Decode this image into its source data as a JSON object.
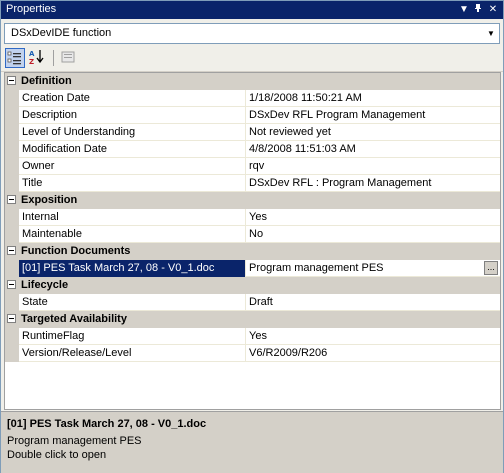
{
  "window": {
    "title": "Properties"
  },
  "object_selector": {
    "value": "DSxDevIDE function"
  },
  "toolbar": {
    "categorized_label": "Categorized",
    "alphabetical_label": "Alphabetical",
    "property_pages_label": "Property Pages"
  },
  "grid": {
    "categories": [
      {
        "name": "Definition",
        "props": [
          {
            "name": "Creation Date",
            "value": "1/18/2008 11:50:21 AM"
          },
          {
            "name": "Description",
            "value": "DSxDev RFL Program Management"
          },
          {
            "name": "Level of Understanding",
            "value": "Not reviewed yet"
          },
          {
            "name": "Modification Date",
            "value": "4/8/2008 11:51:03 AM"
          },
          {
            "name": "Owner",
            "value": "rqv"
          },
          {
            "name": "Title",
            "value": "DSxDev RFL : Program Management"
          }
        ]
      },
      {
        "name": "Exposition",
        "props": [
          {
            "name": "Internal",
            "value": "Yes"
          },
          {
            "name": "Maintenable",
            "value": "No"
          }
        ]
      },
      {
        "name": "Function Documents",
        "props": [
          {
            "name": "[01] PES Task March 27, 08 - V0_1.doc",
            "value": "Program management PES"
          }
        ]
      },
      {
        "name": "Lifecycle",
        "props": [
          {
            "name": "State",
            "value": "Draft"
          }
        ]
      },
      {
        "name": "Targeted Availability",
        "props": [
          {
            "name": "RuntimeFlag",
            "value": "Yes"
          },
          {
            "name": "Version/Release/Level",
            "value": "V6/R2009/R206"
          }
        ]
      }
    ]
  },
  "description": {
    "title": "[01] PES Task March 27, 08 - V0_1.doc",
    "line1": "Program management PES",
    "line2": "Double click to open"
  },
  "colors": {
    "titlebar": "#0a246a",
    "selection": "#0a246a",
    "category_bg": "#d4d0c8"
  }
}
